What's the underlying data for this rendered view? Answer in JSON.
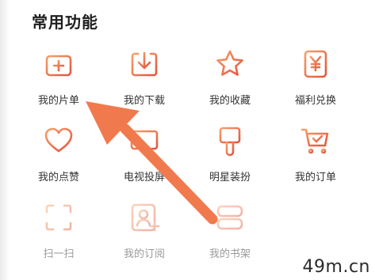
{
  "section": {
    "title": "常用功能"
  },
  "items": [
    {
      "label": "我的片单",
      "icon": "film-list-icon"
    },
    {
      "label": "我的下载",
      "icon": "download-icon"
    },
    {
      "label": "我的收藏",
      "icon": "star-icon"
    },
    {
      "label": "福利兑换",
      "icon": "yen-coupon-icon"
    },
    {
      "label": "我的点赞",
      "icon": "heart-icon"
    },
    {
      "label": "电视投屏",
      "icon": "tv-cast-icon"
    },
    {
      "label": "明星装扮",
      "icon": "paintbrush-icon"
    },
    {
      "label": "我的订单",
      "icon": "cart-icon"
    },
    {
      "label": "扫一扫",
      "icon": "scan-icon"
    },
    {
      "label": "我的订阅",
      "icon": "subscribe-user-icon"
    },
    {
      "label": "我的书架",
      "icon": "bookshelf-icon"
    }
  ],
  "watermark": "49m.cn",
  "colors": {
    "accent_start": "#f6a06a",
    "accent_end": "#e2553e",
    "arrow": "#f07a4e"
  }
}
